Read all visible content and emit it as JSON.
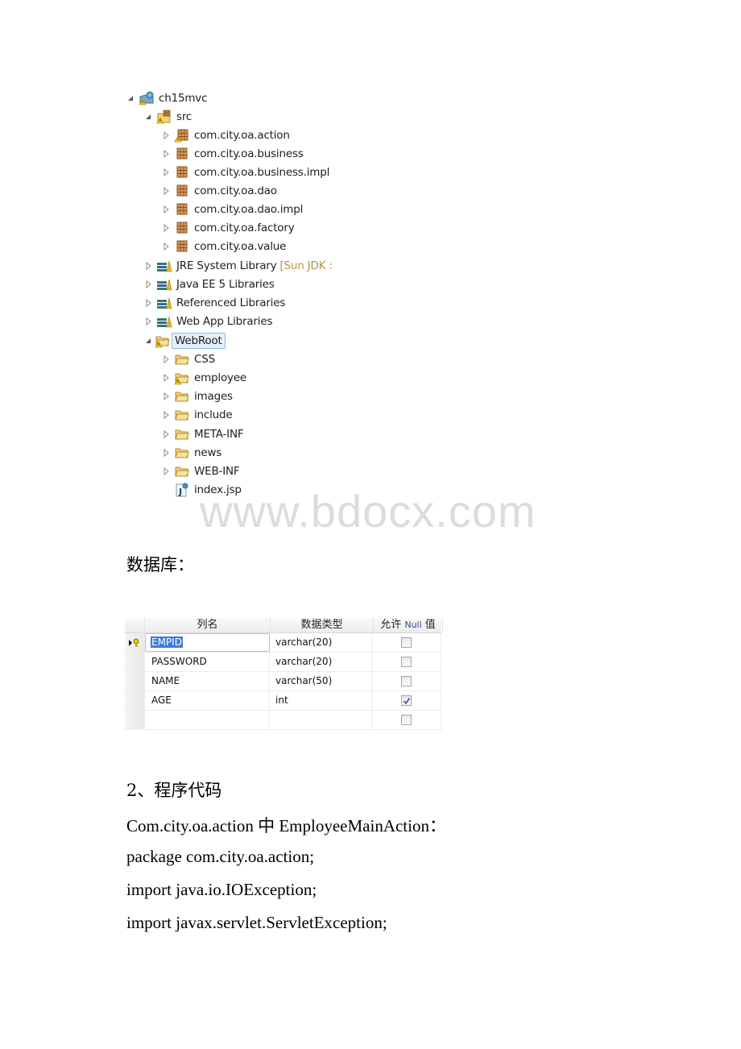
{
  "project_tree": {
    "nodes": [
      {
        "label": "ch15mvc",
        "icon": "web-project-warning-icon",
        "expanded": true,
        "level": 0
      },
      {
        "label": "src",
        "icon": "source-folder-warning-icon",
        "expanded": true,
        "level": 1
      },
      {
        "label": "com.city.oa.action",
        "icon": "package-warning-icon",
        "expanded": false,
        "level": 2
      },
      {
        "label": "com.city.oa.business",
        "icon": "package-icon",
        "expanded": false,
        "level": 2
      },
      {
        "label": "com.city.oa.business.impl",
        "icon": "package-icon",
        "expanded": false,
        "level": 2
      },
      {
        "label": "com.city.oa.dao",
        "icon": "package-icon",
        "expanded": false,
        "level": 2
      },
      {
        "label": "com.city.oa.dao.impl",
        "icon": "package-icon",
        "expanded": false,
        "level": 2
      },
      {
        "label": "com.city.oa.factory",
        "icon": "package-icon",
        "expanded": false,
        "level": 2
      },
      {
        "label": "com.city.oa.value",
        "icon": "package-icon",
        "expanded": false,
        "level": 2
      },
      {
        "label": "JRE System Library",
        "decoration": "[Sun JDK :",
        "icon": "library-icon",
        "expanded": false,
        "level": 1
      },
      {
        "label": "Java EE 5 Libraries",
        "icon": "library-icon",
        "expanded": false,
        "level": 1
      },
      {
        "label": "Referenced Libraries",
        "icon": "library-icon",
        "expanded": false,
        "level": 1
      },
      {
        "label": "Web App Libraries",
        "icon": "library-icon",
        "expanded": false,
        "level": 1
      },
      {
        "label": "WebRoot",
        "icon": "folder-warning-icon",
        "expanded": true,
        "selected": true,
        "level": 1
      },
      {
        "label": "CSS",
        "icon": "folder-icon",
        "expanded": false,
        "level": 2
      },
      {
        "label": "employee",
        "icon": "folder-warning-icon",
        "expanded": false,
        "level": 2
      },
      {
        "label": "images",
        "icon": "folder-icon",
        "expanded": false,
        "level": 2
      },
      {
        "label": "include",
        "icon": "folder-icon",
        "expanded": false,
        "level": 2
      },
      {
        "label": "META-INF",
        "icon": "folder-icon",
        "expanded": false,
        "level": 2
      },
      {
        "label": "news",
        "icon": "folder-icon",
        "expanded": false,
        "level": 2
      },
      {
        "label": "WEB-INF",
        "icon": "folder-icon",
        "expanded": false,
        "level": 2
      },
      {
        "label": "index.jsp",
        "icon": "jsp-file-icon",
        "leaf": true,
        "level": 2
      }
    ]
  },
  "watermark": "www.bdocx.com",
  "database_heading": "数据库：",
  "db_table": {
    "headers": [
      "列名",
      "数据类型",
      "允许",
      "Null",
      "值"
    ],
    "rows": [
      {
        "name": "EMPID",
        "type": "varchar(20)",
        "allow_null": false,
        "primary_key": true,
        "active": true
      },
      {
        "name": "PASSWORD",
        "type": "varchar(20)",
        "allow_null": false
      },
      {
        "name": "NAME",
        "type": "varchar(50)",
        "allow_null": false
      },
      {
        "name": "AGE",
        "type": "int",
        "allow_null": true
      },
      {
        "name": "",
        "type": "",
        "allow_null": false
      }
    ]
  },
  "section_heading": "2、程序代码",
  "code_intro": "Com.city.oa.action 中 EmployeeMainAction：",
  "code_lines": [
    "package com.city.oa.action;",
    "import java.io.IOException;",
    "import javax.servlet.ServletException;"
  ]
}
